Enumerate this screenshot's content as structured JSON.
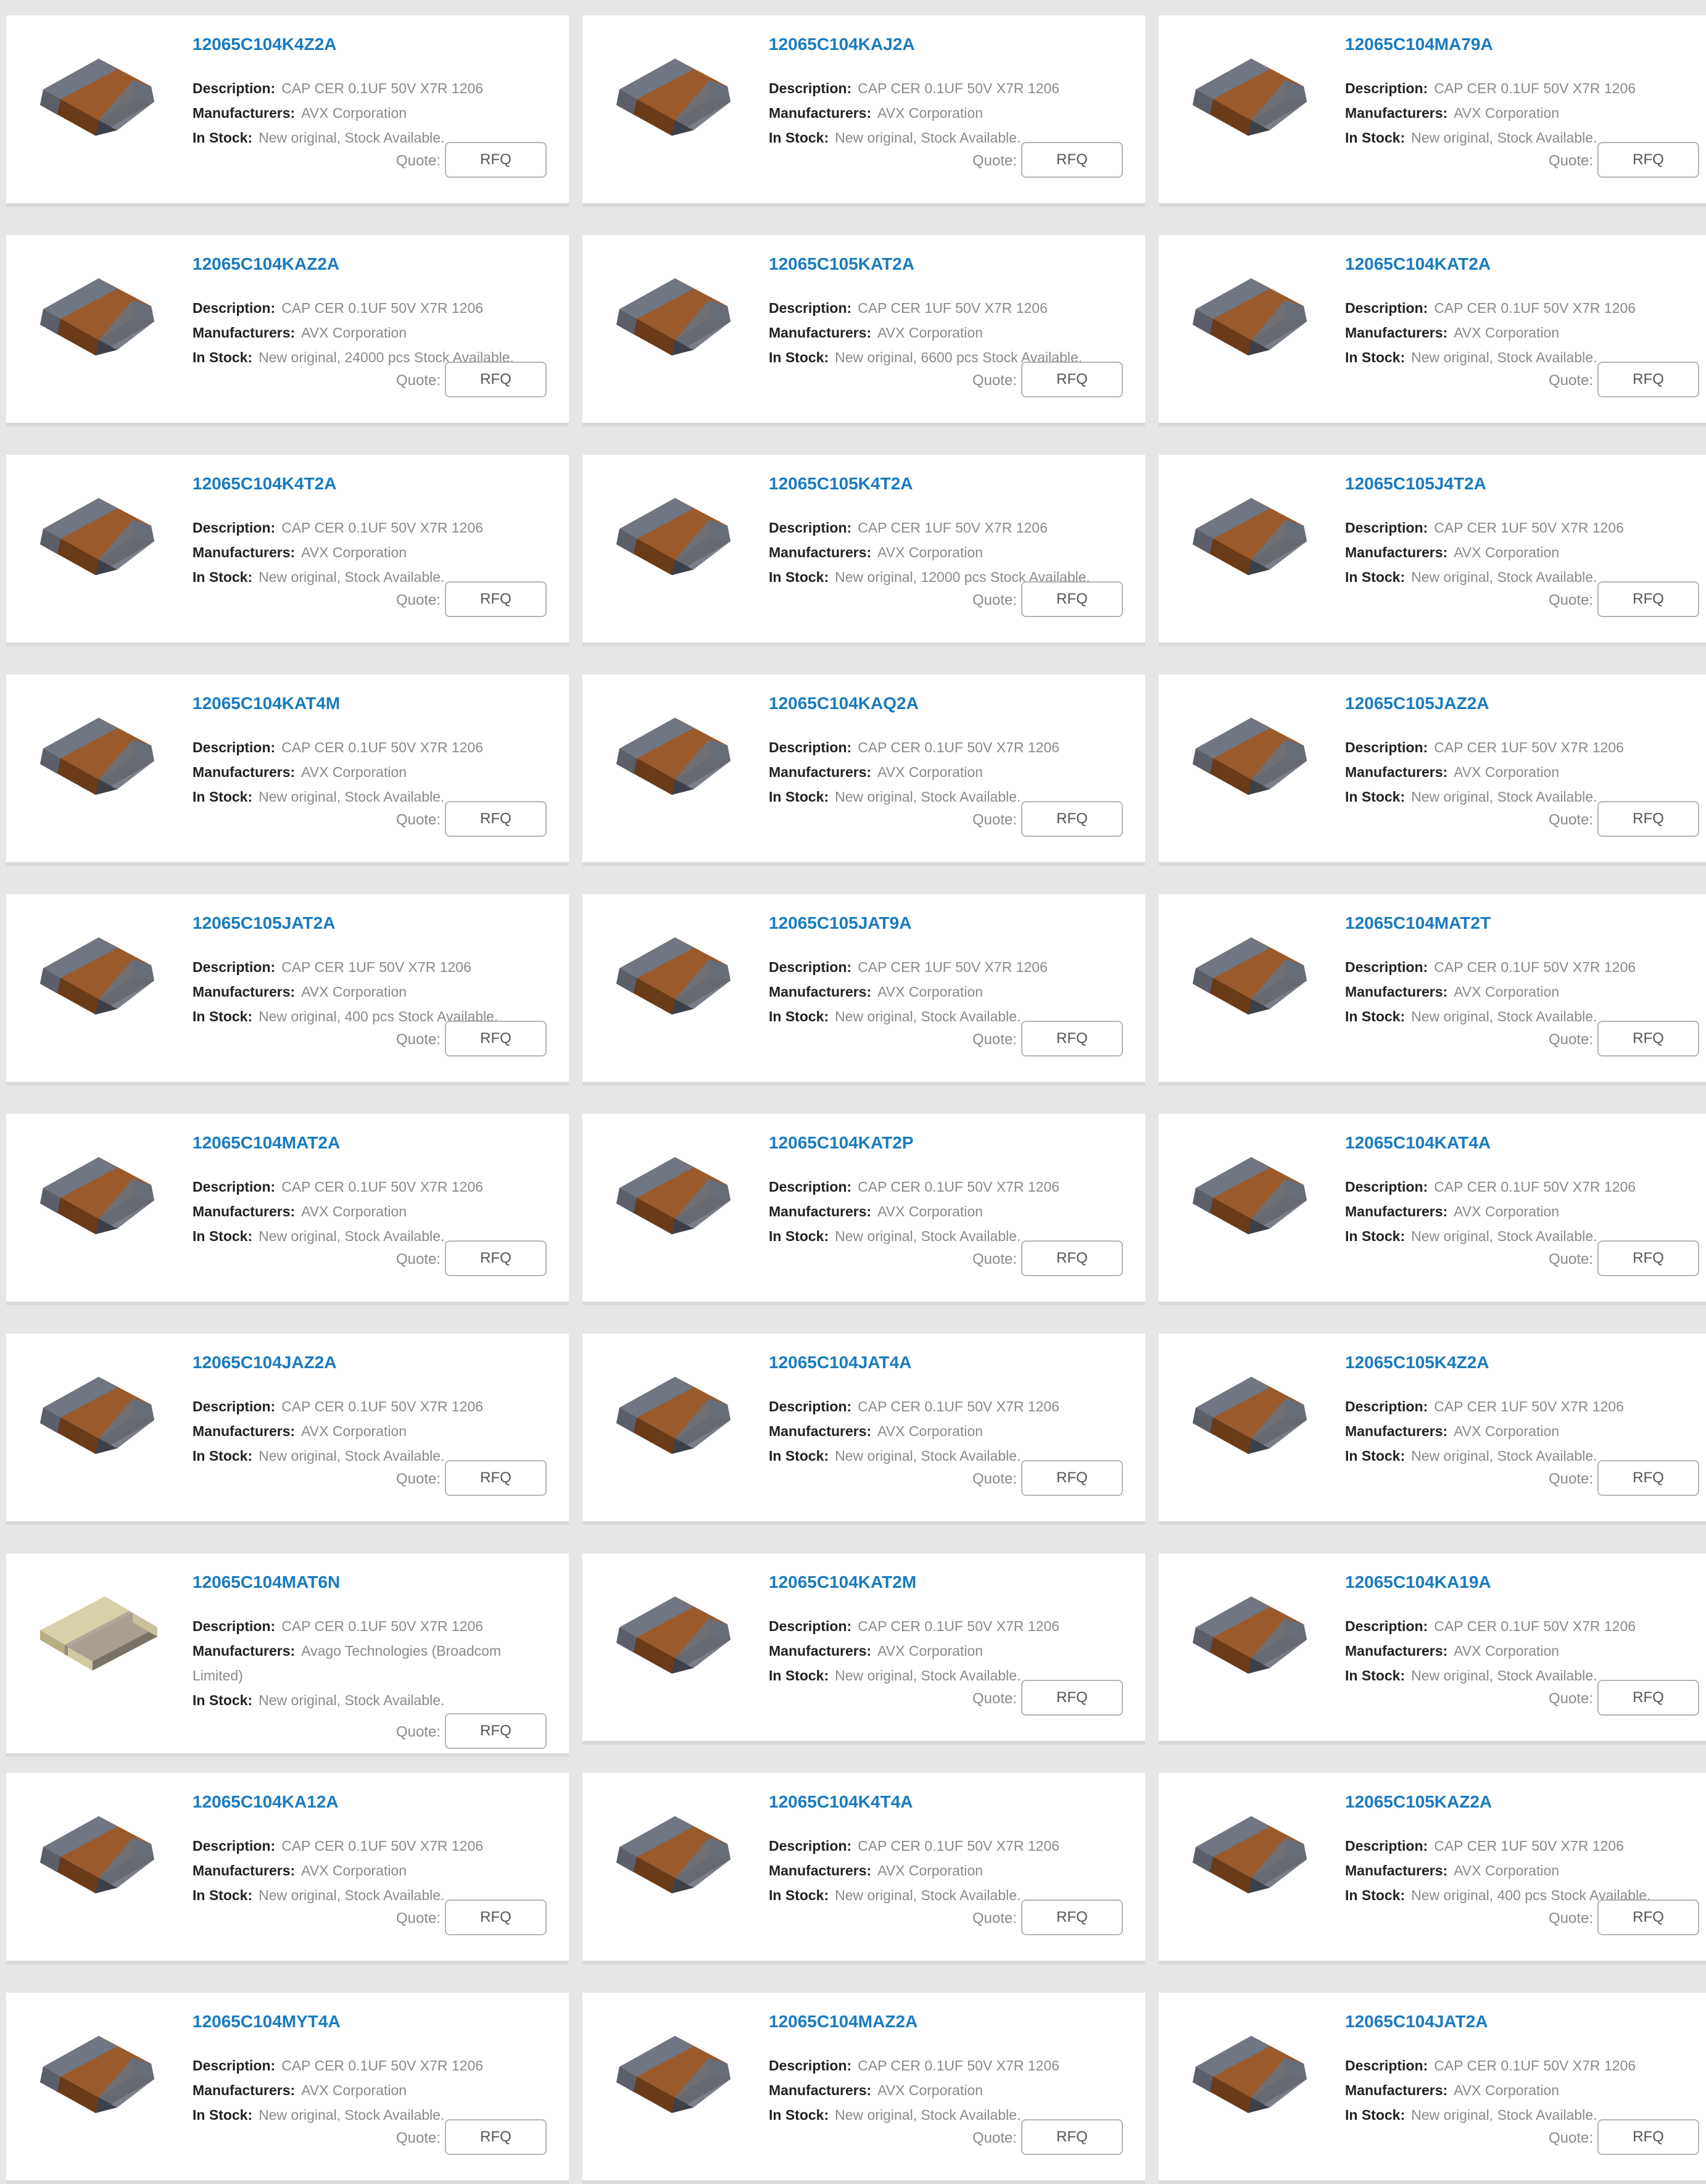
{
  "labels": {
    "description": "Description:",
    "manufacturers": "Manufacturers:",
    "in_stock": "In Stock:",
    "quote": "Quote:",
    "rfq": "RFQ"
  },
  "colors": {
    "part_number": "#1a7bbf",
    "page_background": "#e6e6e6",
    "card_background": "#ffffff"
  },
  "products": [
    {
      "part": "12065C104K4Z2A",
      "description": "CAP CER 0.1UF 50V X7R 1206",
      "manufacturer": "AVX Corporation",
      "stock": "New original, Stock Available.",
      "image": "brown-mlcc-chip"
    },
    {
      "part": "12065C104KAJ2A",
      "description": "CAP CER 0.1UF 50V X7R 1206",
      "manufacturer": "AVX Corporation",
      "stock": "New original, Stock Available.",
      "image": "brown-mlcc-chip"
    },
    {
      "part": "12065C104MA79A",
      "description": "CAP CER 0.1UF 50V X7R 1206",
      "manufacturer": "AVX Corporation",
      "stock": "New original, Stock Available.",
      "image": "brown-mlcc-chip"
    },
    {
      "part": "12065C104KAZ2A",
      "description": "CAP CER 0.1UF 50V X7R 1206",
      "manufacturer": "AVX Corporation",
      "stock": "New original, 24000 pcs Stock Available.",
      "image": "brown-mlcc-chip"
    },
    {
      "part": "12065C105KAT2A",
      "description": "CAP CER 1UF 50V X7R 1206",
      "manufacturer": "AVX Corporation",
      "stock": "New original, 6600 pcs Stock Available.",
      "image": "brown-mlcc-chip"
    },
    {
      "part": "12065C104KAT2A",
      "description": "CAP CER 0.1UF 50V X7R 1206",
      "manufacturer": "AVX Corporation",
      "stock": "New original, Stock Available.",
      "image": "brown-mlcc-chip"
    },
    {
      "part": "12065C104K4T2A",
      "description": "CAP CER 0.1UF 50V X7R 1206",
      "manufacturer": "AVX Corporation",
      "stock": "New original, Stock Available.",
      "image": "brown-mlcc-chip"
    },
    {
      "part": "12065C105K4T2A",
      "description": "CAP CER 1UF 50V X7R 1206",
      "manufacturer": "AVX Corporation",
      "stock": "New original, 12000 pcs Stock Available.",
      "image": "brown-mlcc-chip"
    },
    {
      "part": "12065C105J4T2A",
      "description": "CAP CER 1UF 50V X7R 1206",
      "manufacturer": "AVX Corporation",
      "stock": "New original, Stock Available.",
      "image": "brown-mlcc-chip"
    },
    {
      "part": "12065C104KAT4M",
      "description": "CAP CER 0.1UF 50V X7R 1206",
      "manufacturer": "AVX Corporation",
      "stock": "New original, Stock Available.",
      "image": "brown-mlcc-chip"
    },
    {
      "part": "12065C104KAQ2A",
      "description": "CAP CER 0.1UF 50V X7R 1206",
      "manufacturer": "AVX Corporation",
      "stock": "New original, Stock Available.",
      "image": "brown-mlcc-chip"
    },
    {
      "part": "12065C105JAZ2A",
      "description": "CAP CER 1UF 50V X7R 1206",
      "manufacturer": "AVX Corporation",
      "stock": "New original, Stock Available.",
      "image": "brown-mlcc-chip"
    },
    {
      "part": "12065C105JAT2A",
      "description": "CAP CER 1UF 50V X7R 1206",
      "manufacturer": "AVX Corporation",
      "stock": "New original, 400 pcs Stock Available.",
      "image": "brown-mlcc-chip"
    },
    {
      "part": "12065C105JAT9A",
      "description": "CAP CER 1UF 50V X7R 1206",
      "manufacturer": "AVX Corporation",
      "stock": "New original, Stock Available.",
      "image": "brown-mlcc-chip"
    },
    {
      "part": "12065C104MAT2T",
      "description": "CAP CER 0.1UF 50V X7R 1206",
      "manufacturer": "AVX Corporation",
      "stock": "New original, Stock Available.",
      "image": "brown-mlcc-chip"
    },
    {
      "part": "12065C104MAT2A",
      "description": "CAP CER 0.1UF 50V X7R 1206",
      "manufacturer": "AVX Corporation",
      "stock": "New original, Stock Available.",
      "image": "brown-mlcc-chip"
    },
    {
      "part": "12065C104KAT2P",
      "description": "CAP CER 0.1UF 50V X7R 1206",
      "manufacturer": "AVX Corporation",
      "stock": "New original, Stock Available.",
      "image": "brown-mlcc-chip"
    },
    {
      "part": "12065C104KAT4A",
      "description": "CAP CER 0.1UF 50V X7R 1206",
      "manufacturer": "AVX Corporation",
      "stock": "New original, Stock Available.",
      "image": "brown-mlcc-chip"
    },
    {
      "part": "12065C104JAZ2A",
      "description": "CAP CER 0.1UF 50V X7R 1206",
      "manufacturer": "AVX Corporation",
      "stock": "New original, Stock Available.",
      "image": "brown-mlcc-chip"
    },
    {
      "part": "12065C104JAT4A",
      "description": "CAP CER 0.1UF 50V X7R 1206",
      "manufacturer": "AVX Corporation",
      "stock": "New original, Stock Available.",
      "image": "brown-mlcc-chip"
    },
    {
      "part": "12065C105K4Z2A",
      "description": "CAP CER 1UF 50V X7R 1206",
      "manufacturer": "AVX Corporation",
      "stock": "New original, Stock Available.",
      "image": "brown-mlcc-chip"
    },
    {
      "part": "12065C104MAT6N",
      "description": "CAP CER 0.1UF 50V X7R 1206",
      "manufacturer": "Avago Technologies (Broadcom Limited)",
      "stock": "New original, Stock Available.",
      "image": "gray-mlcc-chip"
    },
    {
      "part": "12065C104KAT2M",
      "description": "CAP CER 0.1UF 50V X7R 1206",
      "manufacturer": "AVX Corporation",
      "stock": "New original, Stock Available.",
      "image": "brown-mlcc-chip"
    },
    {
      "part": "12065C104KA19A",
      "description": "CAP CER 0.1UF 50V X7R 1206",
      "manufacturer": "AVX Corporation",
      "stock": "New original, Stock Available.",
      "image": "brown-mlcc-chip"
    },
    {
      "part": "12065C104KA12A",
      "description": "CAP CER 0.1UF 50V X7R 1206",
      "manufacturer": "AVX Corporation",
      "stock": "New original, Stock Available.",
      "image": "brown-mlcc-chip"
    },
    {
      "part": "12065C104K4T4A",
      "description": "CAP CER 0.1UF 50V X7R 1206",
      "manufacturer": "AVX Corporation",
      "stock": "New original, Stock Available.",
      "image": "brown-mlcc-chip"
    },
    {
      "part": "12065C105KAZ2A",
      "description": "CAP CER 1UF 50V X7R 1206",
      "manufacturer": "AVX Corporation",
      "stock": "New original, 400 pcs Stock Available.",
      "image": "brown-mlcc-chip"
    },
    {
      "part": "12065C104MYT4A",
      "description": "CAP CER 0.1UF 50V X7R 1206",
      "manufacturer": "AVX Corporation",
      "stock": "New original, Stock Available.",
      "image": "brown-mlcc-chip"
    },
    {
      "part": "12065C104MAZ2A",
      "description": "CAP CER 0.1UF 50V X7R 1206",
      "manufacturer": "AVX Corporation",
      "stock": "New original, Stock Available.",
      "image": "brown-mlcc-chip"
    },
    {
      "part": "12065C104JAT2A",
      "description": "CAP CER 0.1UF 50V X7R 1206",
      "manufacturer": "AVX Corporation",
      "stock": "New original, Stock Available.",
      "image": "brown-mlcc-chip"
    }
  ]
}
